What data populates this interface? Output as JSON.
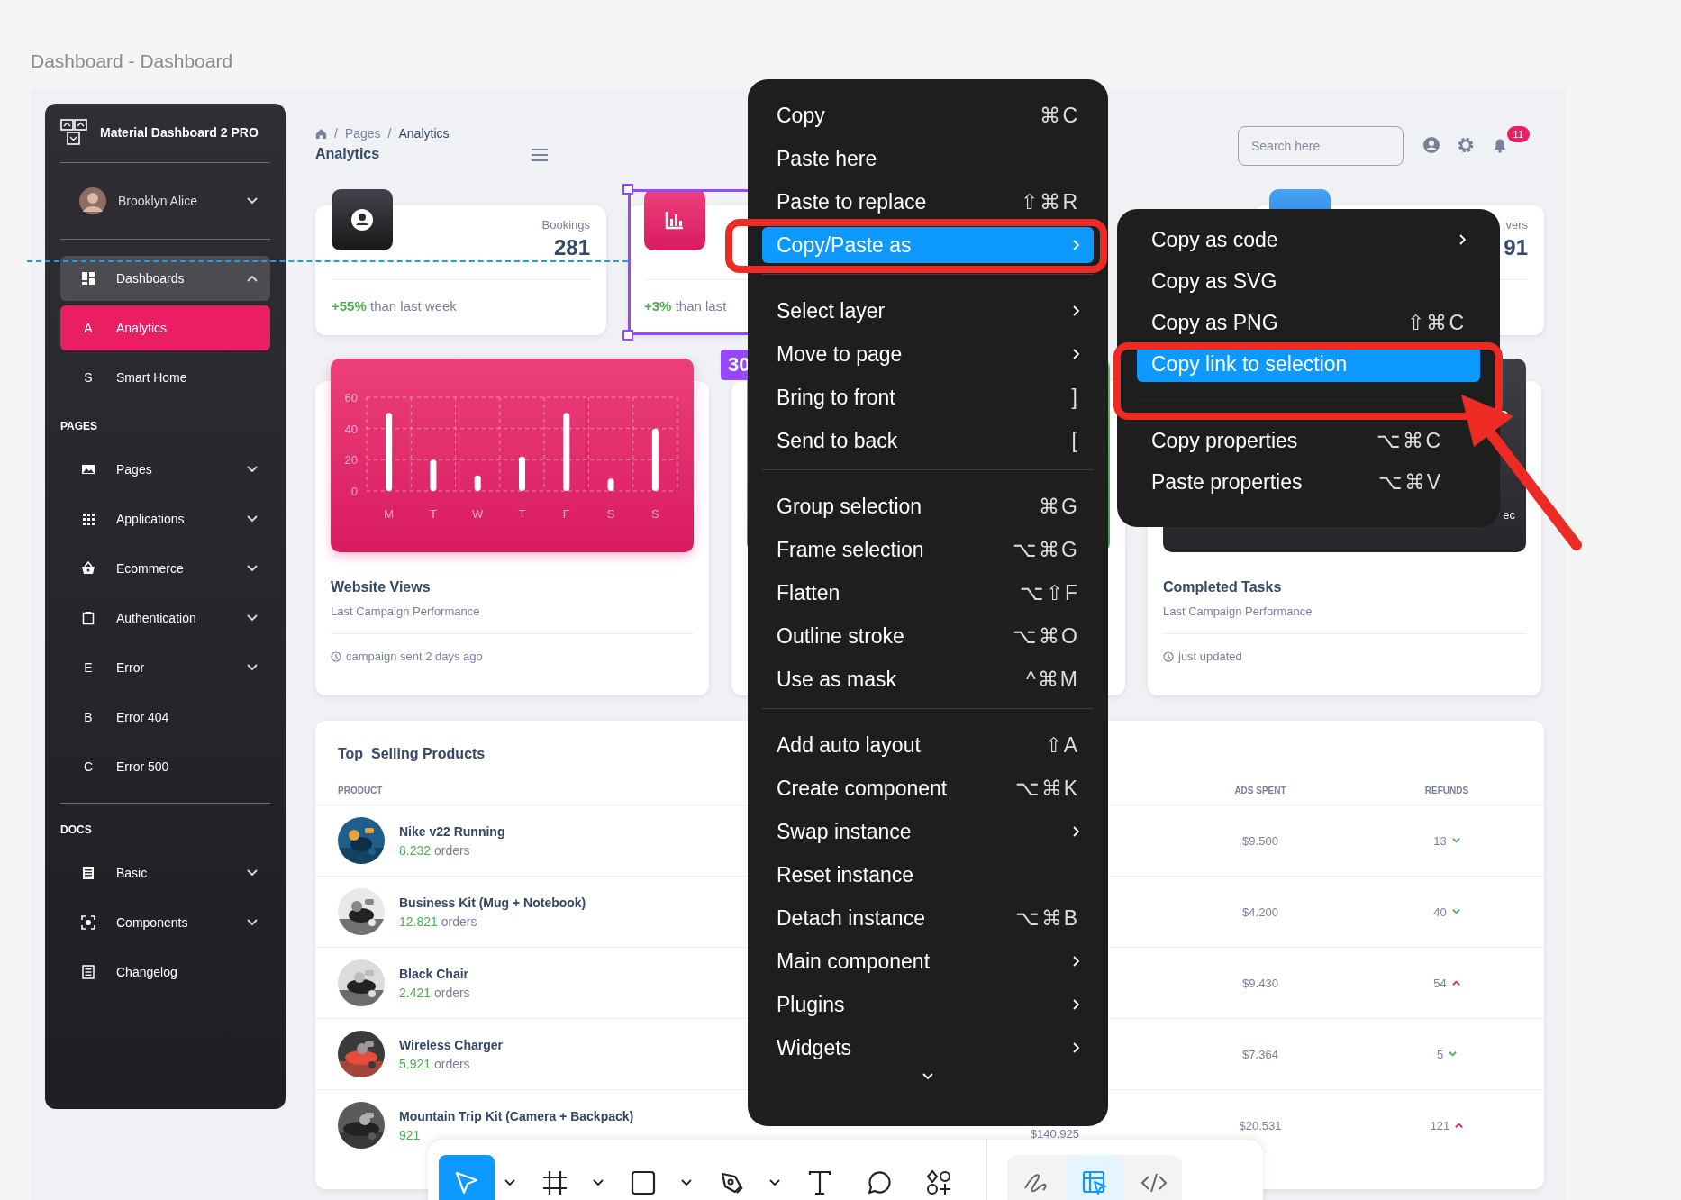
{
  "canvas": {
    "frame_title": "Dashboard - Dashboard",
    "size_label": "30"
  },
  "sidebar": {
    "brand": "Material Dashboard 2 PRO",
    "user": {
      "name": "Brooklyn Alice",
      "expanded": false
    },
    "items": [
      {
        "kind": "nav",
        "label": "Dashboards",
        "expanded": true,
        "selected": false
      },
      {
        "kind": "letter",
        "letter": "A",
        "label": "Analytics",
        "selected": true
      },
      {
        "kind": "letter",
        "letter": "S",
        "label": "Smart Home",
        "selected": false
      },
      {
        "kind": "heading",
        "label": "PAGES"
      },
      {
        "kind": "nav",
        "label": "Pages",
        "expanded": false,
        "selected": false
      },
      {
        "kind": "nav",
        "label": "Applications",
        "expanded": false,
        "selected": false
      },
      {
        "kind": "nav",
        "label": "Ecommerce",
        "expanded": false,
        "selected": false
      },
      {
        "kind": "nav",
        "label": "Authentication",
        "expanded": false,
        "selected": false
      },
      {
        "kind": "letter",
        "letter": "E",
        "label": "Error",
        "expanded": false,
        "selected": false
      },
      {
        "kind": "letter",
        "letter": "B",
        "label": "Error 404",
        "selected": false
      },
      {
        "kind": "letter",
        "letter": "C",
        "label": "Error 500",
        "selected": false
      },
      {
        "kind": "divider"
      },
      {
        "kind": "heading",
        "label": "DOCS"
      },
      {
        "kind": "nav",
        "label": "Basic",
        "expanded": false,
        "selected": false
      },
      {
        "kind": "nav",
        "label": "Components",
        "expanded": false,
        "selected": false
      },
      {
        "kind": "nav",
        "label": "Changelog",
        "selected": false
      }
    ]
  },
  "header": {
    "breadcrumb": [
      "Pages",
      "Analytics"
    ],
    "breadcrumb_separator": "/",
    "title": "Analytics",
    "search": {
      "placeholder": "Search here"
    },
    "notifications": "11"
  },
  "stats": [
    {
      "label": "Bookings",
      "value": "281",
      "change": "+55%",
      "note": "than last week"
    },
    {
      "change": "+3%",
      "note": "than last"
    },
    {
      "label": "vers",
      "value": "91"
    }
  ],
  "chart_cards": [
    {
      "kind": "pink",
      "title": "Website Views",
      "subtitle": "Last Campaign Performance",
      "footer": "campaign sent 2 days ago",
      "chart_data": {
        "type": "bar",
        "categories": [
          "M",
          "T",
          "W",
          "T",
          "F",
          "S",
          "S"
        ],
        "values": [
          50,
          20,
          10,
          22,
          50,
          8,
          40
        ],
        "ylim": [
          0,
          60
        ],
        "yticks": [
          0,
          20,
          40,
          60
        ]
      }
    },
    {
      "kind": "green"
    },
    {
      "kind": "dark",
      "fragment": "ec",
      "title": "Completed Tasks",
      "subtitle": "Last Campaign Performance",
      "footer": "just updated"
    }
  ],
  "table": {
    "title": "Top  Selling Products",
    "columns": [
      "PRODUCT",
      "ADS SPENT",
      "REFUNDS"
    ],
    "rows": [
      {
        "name": "Nike v22 Running",
        "orders": "8.232",
        "orders_label": "orders",
        "ads_spent": "$9.500",
        "refunds": "13",
        "rising": false
      },
      {
        "name": "Business Kit (Mug + Notebook)",
        "orders": "12.821",
        "orders_label": "orders",
        "ads_spent": "$4.200",
        "refunds": "40",
        "rising": false
      },
      {
        "name": "Black Chair",
        "orders": "2.421",
        "orders_label": "orders",
        "ads_spent": "$9.430",
        "refunds": "54",
        "rising": true
      },
      {
        "name": "Wireless Charger",
        "orders": "5.921",
        "orders_label": "orders",
        "ads_spent": "$7.364",
        "refunds": "5",
        "rising": false
      },
      {
        "name": "Mountain Trip Kit (Camera + Backpack)",
        "orders": "921",
        "column_3": "$140.925",
        "ads_spent": "$20.531",
        "refunds": "121",
        "rising": true
      }
    ]
  },
  "context_menu": {
    "items": [
      {
        "kind": "item",
        "label": "Copy",
        "shortcut": "⌘C",
        "submenu": false,
        "selected": false
      },
      {
        "kind": "item",
        "label": "Paste here",
        "submenu": false,
        "selected": false
      },
      {
        "kind": "item",
        "label": "Paste to replace",
        "shortcut": "⇧⌘R",
        "submenu": false,
        "selected": false
      },
      {
        "kind": "item",
        "label": "Copy/Paste as",
        "submenu": true,
        "selected": true
      },
      {
        "kind": "divider"
      },
      {
        "kind": "item",
        "label": "Select layer",
        "submenu": true,
        "selected": false
      },
      {
        "kind": "item",
        "label": "Move to page",
        "submenu": true,
        "selected": false
      },
      {
        "kind": "item",
        "label": "Bring to front",
        "shortcut": "]",
        "submenu": false,
        "selected": false
      },
      {
        "kind": "item",
        "label": "Send to back",
        "shortcut": "[",
        "submenu": false,
        "selected": false
      },
      {
        "kind": "divider"
      },
      {
        "kind": "item",
        "label": "Group selection",
        "shortcut": "⌘G",
        "submenu": false,
        "selected": false
      },
      {
        "kind": "item",
        "label": "Frame selection",
        "shortcut": "⌥⌘G",
        "submenu": false,
        "selected": false
      },
      {
        "kind": "item",
        "label": "Flatten",
        "shortcut": "⌥⇧F",
        "submenu": false,
        "selected": false
      },
      {
        "kind": "item",
        "label": "Outline stroke",
        "shortcut": "⌥⌘O",
        "submenu": false,
        "selected": false
      },
      {
        "kind": "item",
        "label": "Use as mask",
        "shortcut": "^⌘M",
        "submenu": false,
        "selected": false
      },
      {
        "kind": "divider"
      },
      {
        "kind": "item",
        "label": "Add auto layout",
        "shortcut": "⇧A",
        "submenu": false,
        "selected": false
      },
      {
        "kind": "item",
        "label": "Create component",
        "shortcut": "⌥⌘K",
        "submenu": false,
        "selected": false
      },
      {
        "kind": "item",
        "label": "Swap instance",
        "submenu": true,
        "selected": false
      },
      {
        "kind": "item",
        "label": "Reset instance",
        "submenu": false,
        "selected": false
      },
      {
        "kind": "item",
        "label": "Detach instance",
        "shortcut": "⌥⌘B",
        "submenu": false,
        "selected": false
      },
      {
        "kind": "item",
        "label": "Main component",
        "submenu": true,
        "selected": false
      },
      {
        "kind": "item",
        "label": "Plugins",
        "submenu": true,
        "selected": false
      },
      {
        "kind": "item",
        "label": "Widgets",
        "submenu": true,
        "selected": false
      }
    ]
  },
  "submenu": {
    "items": [
      {
        "kind": "item",
        "label": "Copy as code",
        "submenu": true,
        "selected": false
      },
      {
        "kind": "item",
        "label": "Copy as SVG",
        "submenu": false,
        "selected": false
      },
      {
        "kind": "item",
        "label": "Copy as PNG",
        "shortcut": "⇧⌘C",
        "submenu": false,
        "selected": false
      },
      {
        "kind": "item",
        "label": "Copy link to selection",
        "submenu": false,
        "selected": true
      },
      {
        "kind": "divider"
      },
      {
        "kind": "item",
        "label": "Copy properties",
        "shortcut": "⌥⌘C",
        "submenu": false,
        "selected": false
      },
      {
        "kind": "item",
        "label": "Paste properties",
        "shortcut": "⌥⌘V",
        "submenu": false,
        "selected": false
      }
    ]
  },
  "toolbar": {
    "tools": [
      {
        "selected": true,
        "caret": true
      },
      {
        "selected": false,
        "caret": true
      },
      {
        "selected": false,
        "caret": true
      },
      {
        "selected": false,
        "caret": true
      },
      {
        "selected": false,
        "caret": false
      },
      {
        "selected": false,
        "caret": false
      },
      {
        "selected": false,
        "caret": false
      }
    ],
    "modes": [
      {
        "selected": false
      },
      {
        "selected": true
      },
      {
        "selected": false
      }
    ]
  }
}
